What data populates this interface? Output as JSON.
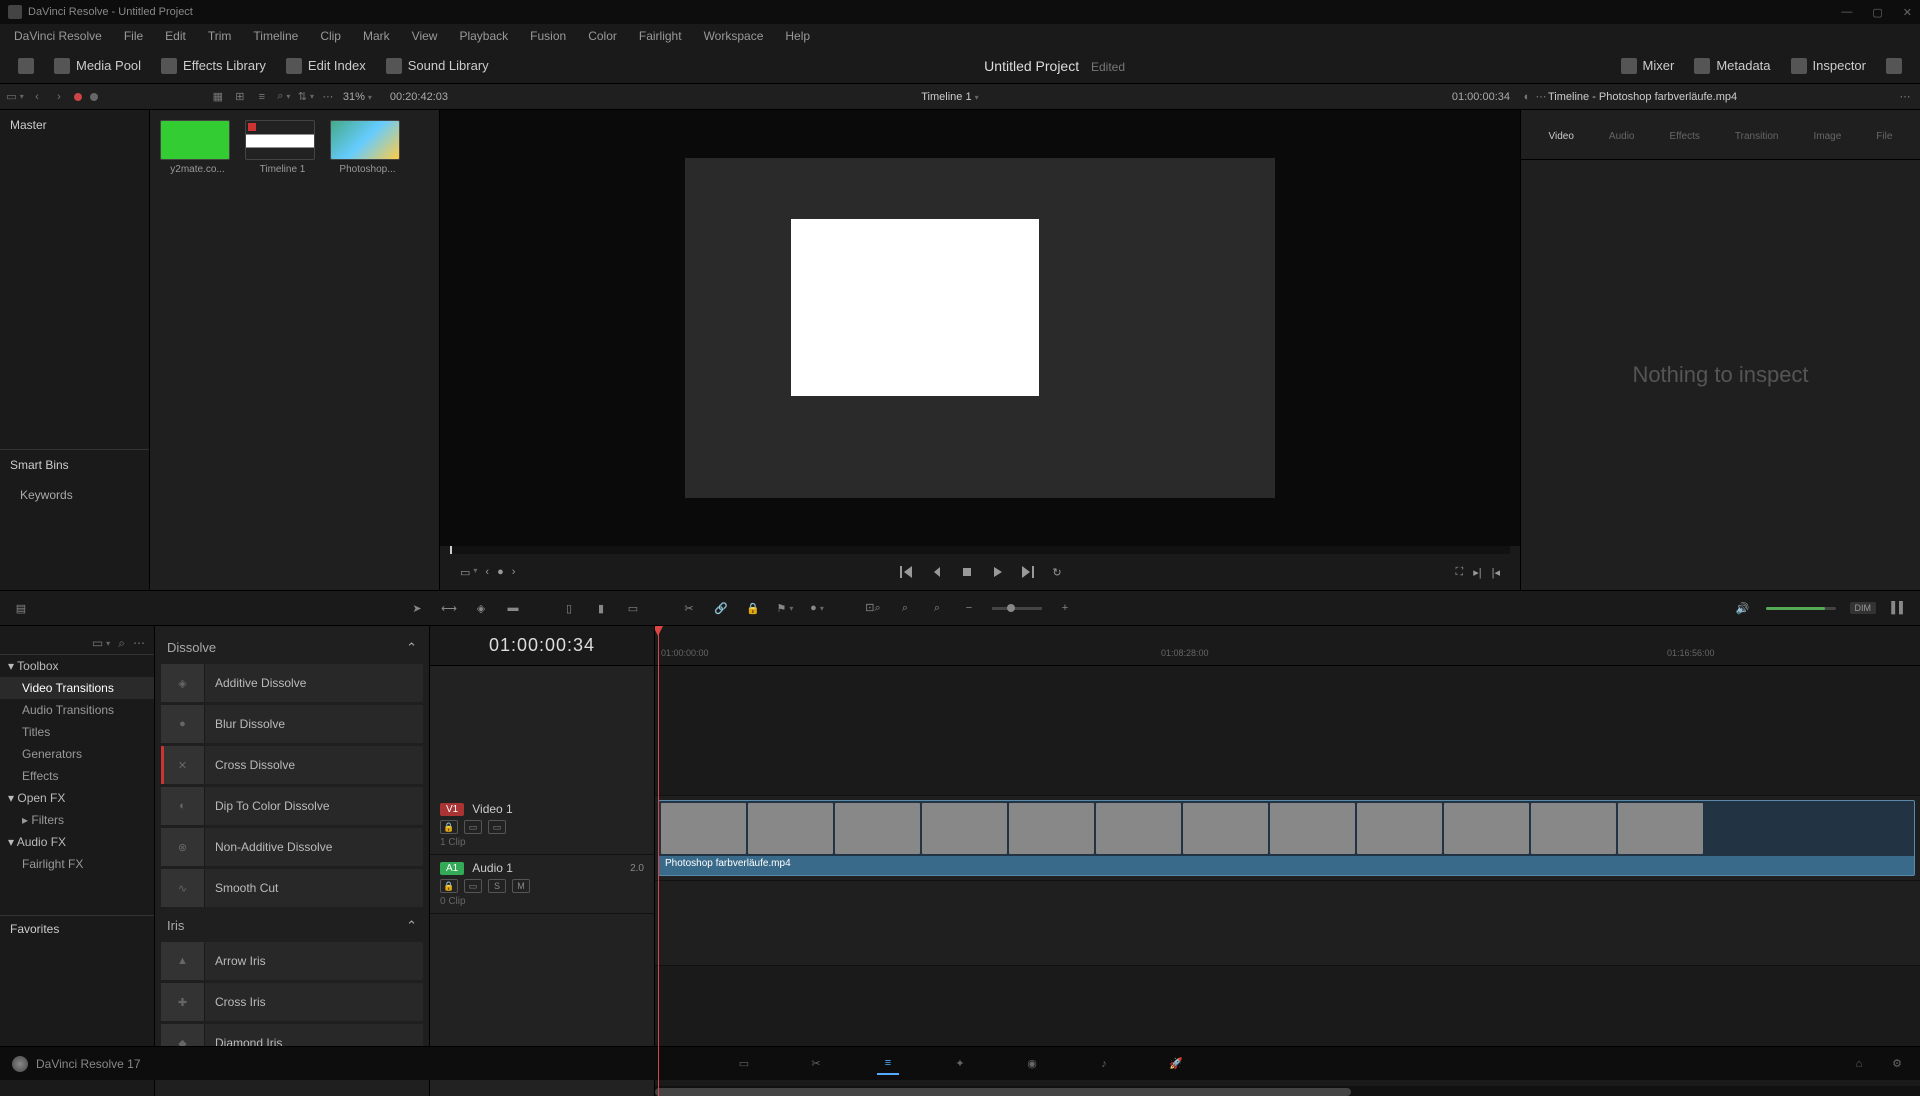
{
  "window": {
    "title": "DaVinci Resolve - Untitled Project"
  },
  "menu": [
    "DaVinci Resolve",
    "File",
    "Edit",
    "Trim",
    "Timeline",
    "Clip",
    "Mark",
    "View",
    "Playback",
    "Fusion",
    "Color",
    "Fairlight",
    "Workspace",
    "Help"
  ],
  "top_toolbar": {
    "media_pool": "Media Pool",
    "effects_library": "Effects Library",
    "edit_index": "Edit Index",
    "sound_library": "Sound Library",
    "project_title": "Untitled Project",
    "edited": "Edited",
    "mixer": "Mixer",
    "metadata": "Metadata",
    "inspector": "Inspector"
  },
  "upper_strip": {
    "zoom_pct": "31%",
    "source_tc": "00:20:42:03",
    "timeline_name": "Timeline 1",
    "record_tc": "01:00:00:34",
    "inspector_title": "Timeline - Photoshop farbverläufe.mp4"
  },
  "bins": {
    "master": "Master",
    "smart_bins": "Smart Bins",
    "keywords": "Keywords"
  },
  "pool_items": [
    {
      "label": "y2mate.co...",
      "thumb": "green"
    },
    {
      "label": "Timeline 1",
      "thumb": "timeline"
    },
    {
      "label": "Photoshop...",
      "thumb": "photoshop"
    }
  ],
  "inspector": {
    "tabs": [
      "Video",
      "Audio",
      "Effects",
      "Transition",
      "Image",
      "File"
    ],
    "empty": "Nothing to inspect"
  },
  "fx_tree": {
    "toolbox": "Toolbox",
    "items": [
      "Video Transitions",
      "Audio Transitions",
      "Titles",
      "Generators",
      "Effects"
    ],
    "openfx": "Open FX",
    "filters": "Filters",
    "audiofx": "Audio FX",
    "fairlightfx": "Fairlight FX",
    "favorites": "Favorites"
  },
  "fx_list": {
    "group1": "Dissolve",
    "items1": [
      "Additive Dissolve",
      "Blur Dissolve",
      "Cross Dissolve",
      "Dip To Color Dissolve",
      "Non-Additive Dissolve",
      "Smooth Cut"
    ],
    "group2": "Iris",
    "items2": [
      "Arrow Iris",
      "Cross Iris",
      "Diamond Iris"
    ]
  },
  "timeline": {
    "tc_main": "01:00:00:34",
    "ruler": [
      "01:00:00:00",
      "01:08:28:00",
      "01:16:56:00"
    ],
    "v1": {
      "badge": "V1",
      "name": "Video 1",
      "clips": "1 Clip"
    },
    "a1": {
      "badge": "A1",
      "name": "Audio 1",
      "ch": "2.0",
      "clips": "0 Clip",
      "s": "S",
      "m": "M"
    },
    "clip_name": "Photoshop farbverläufe.mp4"
  },
  "bottombar": {
    "app": "DaVinci Resolve 17"
  },
  "dim_label": "DIM"
}
